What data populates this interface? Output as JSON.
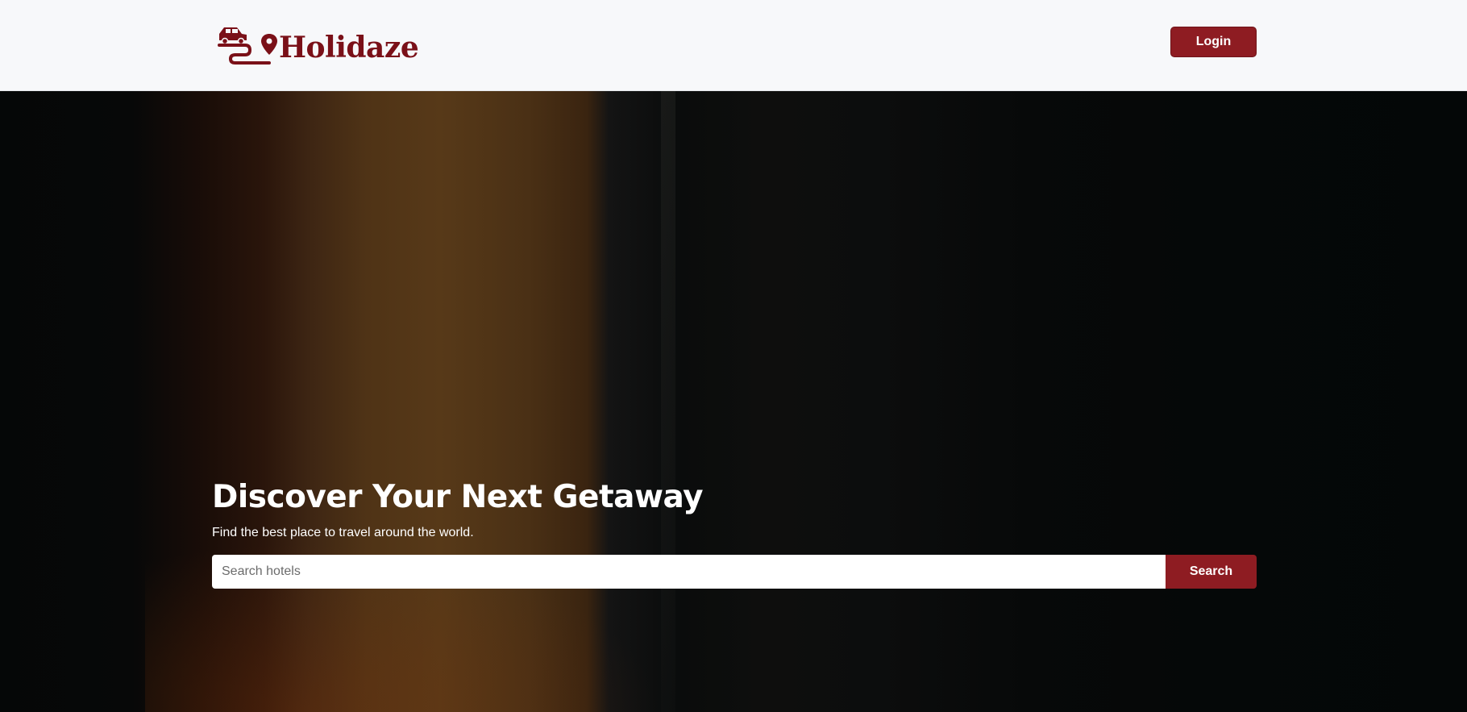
{
  "header": {
    "brand": "Holidaze",
    "logo_icon": "car-route-pin-icon",
    "login_label": "Login"
  },
  "hero": {
    "title": "Discover Your Next Getaway",
    "subtitle": "Find the best place to travel around the world.",
    "search": {
      "placeholder": "Search hotels",
      "value": "",
      "button_label": "Search"
    }
  },
  "colors": {
    "brand": "#7a1018",
    "button": "#8e1c22",
    "header_bg": "#f7f8fa"
  }
}
